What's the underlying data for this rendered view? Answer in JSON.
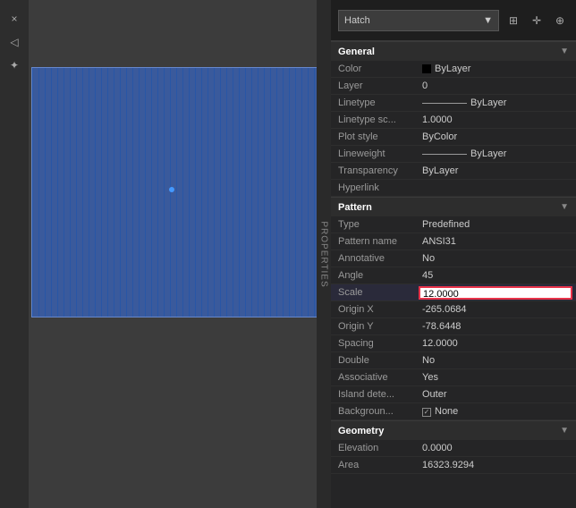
{
  "toolbar": {
    "close_icon": "×",
    "pin_icon": "📌",
    "settings_icon": "⚙"
  },
  "header": {
    "title": "Hatch",
    "dropdown_arrow": "▼",
    "icon1": "⊞",
    "icon2": "+",
    "icon3": "⊕"
  },
  "general_section": {
    "title": "General",
    "arrow": "▼",
    "rows": [
      {
        "label": "Color",
        "value": "ByLayer",
        "has_swatch": true
      },
      {
        "label": "Layer",
        "value": "0"
      },
      {
        "label": "Linetype",
        "value": "ByLayer",
        "has_line": true
      },
      {
        "label": "Linetype sc...",
        "value": "1.0000"
      },
      {
        "label": "Plot style",
        "value": "ByColor"
      },
      {
        "label": "Lineweight",
        "value": "ByLayer",
        "has_line": true
      },
      {
        "label": "Transparency",
        "value": "ByLayer"
      },
      {
        "label": "Hyperlink",
        "value": ""
      }
    ]
  },
  "pattern_section": {
    "title": "Pattern",
    "arrow": "▼",
    "rows": [
      {
        "label": "Type",
        "value": "Predefined"
      },
      {
        "label": "Pattern name",
        "value": "ANSI31"
      },
      {
        "label": "Annotative",
        "value": "No"
      },
      {
        "label": "Angle",
        "value": "45"
      },
      {
        "label": "Scale",
        "value": "12.0000",
        "highlighted": true
      },
      {
        "label": "Origin X",
        "value": "-265.0684"
      },
      {
        "label": "Origin Y",
        "value": "-78.6448"
      },
      {
        "label": "Spacing",
        "value": "12.0000"
      },
      {
        "label": "Double",
        "value": "No"
      },
      {
        "label": "Associative",
        "value": "Yes"
      },
      {
        "label": "Island dete...",
        "value": "Outer"
      },
      {
        "label": "Backgroun...",
        "value": "None",
        "has_checkbox": true
      }
    ]
  },
  "geometry_section": {
    "title": "Geometry",
    "arrow": "▼",
    "rows": [
      {
        "label": "Elevation",
        "value": "0.0000"
      },
      {
        "label": "Area",
        "value": "16323.9294"
      }
    ]
  },
  "properties_label": "PROPERTIES"
}
